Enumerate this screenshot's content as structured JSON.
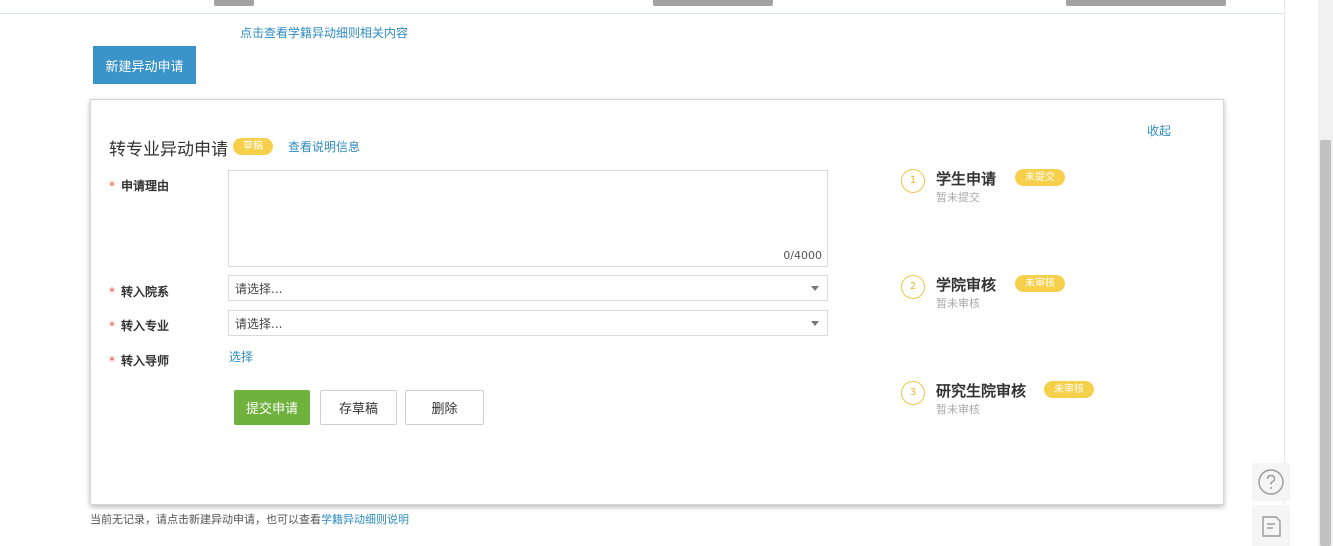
{
  "page": {
    "rules_link": "点击查看学籍异动细则相关内容",
    "new_button": "新建异动申请"
  },
  "card": {
    "collapse_label": "收起",
    "title": "转专业异动申请",
    "status_badge": "草稿",
    "info_link": "查看说明信息",
    "fields": {
      "reason_label": "申请理由",
      "reason_value": "",
      "reason_counter": "0/4000",
      "department_label": "转入院系",
      "department_value": "请选择...",
      "major_label": "转入专业",
      "major_value": "请选择...",
      "supervisor_label": "转入导师",
      "supervisor_link": "选择"
    },
    "buttons": {
      "submit": "提交申请",
      "save_draft": "存草稿",
      "delete": "删除"
    },
    "steps": [
      {
        "number": "1",
        "name": "学生申请",
        "badge": "未提交",
        "status": "暂未提交"
      },
      {
        "number": "2",
        "name": "学院审核",
        "badge": "未审核",
        "status": "暂未审核"
      },
      {
        "number": "3",
        "name": "研究生院审核",
        "badge": "未审核",
        "status": "暂未审核"
      }
    ],
    "required_mark": "*"
  },
  "footer": {
    "text": "当前无记录，请点击新建异动申请，也可以查看",
    "link": "学籍异动细则说明"
  },
  "colors": {
    "primary_blue": "#3a93c9",
    "link_blue": "#2e8bbf",
    "submit_green": "#6fb23e",
    "badge_yellow": "#f6cf4b",
    "required_red": "#e2534a"
  },
  "icons": {
    "help": "question-circle-icon",
    "feedback": "edit-note-icon",
    "dropdown": "caret-down-icon"
  }
}
